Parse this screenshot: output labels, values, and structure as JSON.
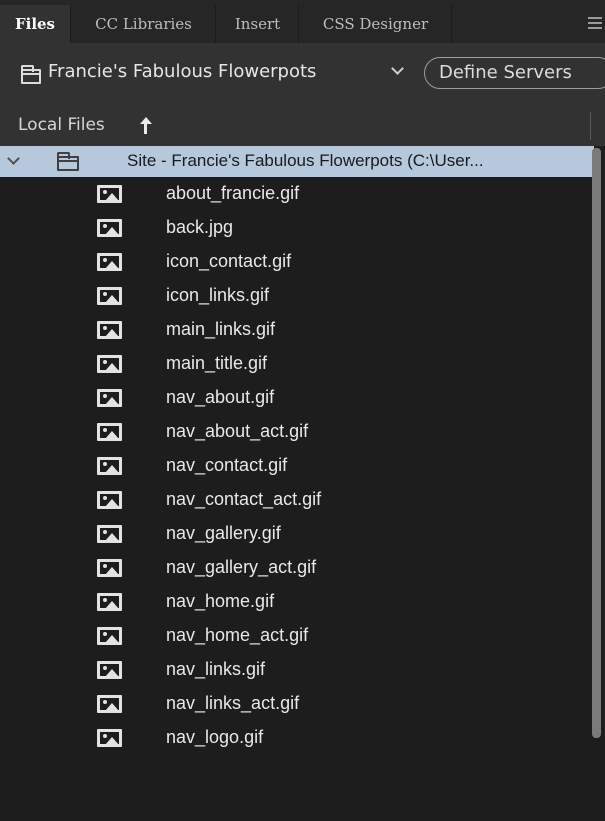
{
  "tabs": [
    {
      "label": "Files",
      "active": true
    },
    {
      "label": "CC Libraries",
      "active": false
    },
    {
      "label": "Insert",
      "active": false
    },
    {
      "label": "CSS Designer",
      "active": false
    }
  ],
  "site_selector": {
    "selected": "Francie's Fabulous Flowerpots",
    "icon": "folder-icon"
  },
  "define_servers_label": "Define Servers",
  "files_header": {
    "title": "Local Files",
    "sort_icon": "arrow-up-icon"
  },
  "tree": {
    "root_label": "Site - Francie's Fabulous Flowerpots (C:\\User...",
    "root_expanded": true,
    "files": [
      "about_francie.gif",
      "back.jpg",
      "icon_contact.gif",
      "icon_links.gif",
      "main_links.gif",
      "main_title.gif",
      "nav_about.gif",
      "nav_about_act.gif",
      "nav_contact.gif",
      "nav_contact_act.gif",
      "nav_gallery.gif",
      "nav_gallery_act.gif",
      "nav_home.gif",
      "nav_home_act.gif",
      "nav_links.gif",
      "nav_links_act.gif",
      "nav_logo.gif"
    ]
  },
  "colors": {
    "panel_bg": "#323232",
    "tree_bg": "#1d1d1d",
    "selection": "#b5c8dc",
    "tabbar_bg": "#262626"
  }
}
